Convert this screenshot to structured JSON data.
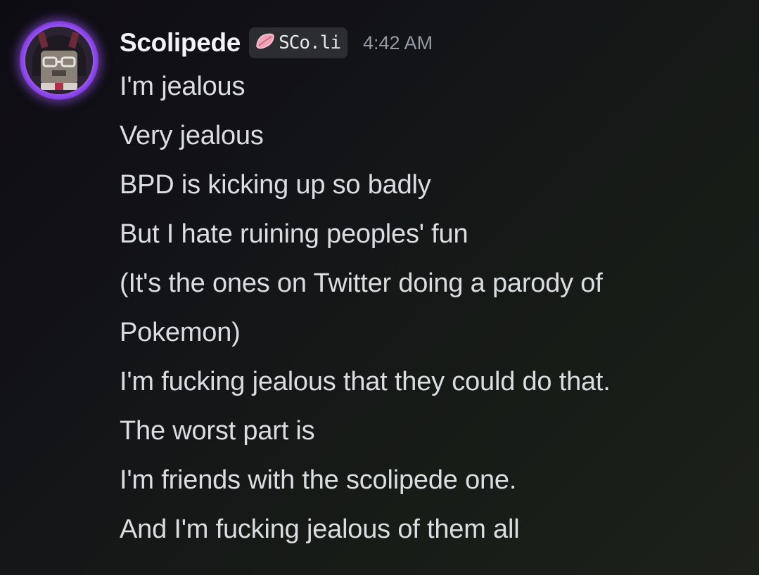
{
  "message": {
    "author": "Scolipede",
    "tag": {
      "icon": "pink-leaf-icon",
      "label": "SCo.li"
    },
    "timestamp": "4:42 AM",
    "avatar_ring_color": "#a768ff",
    "lines": [
      "I'm jealous",
      "Very jealous",
      "BPD is kicking up so badly",
      "But I hate ruining peoples' fun",
      "(It's the ones on Twitter doing a parody of",
      "Pokemon)",
      "I'm fucking jealous that they could do that.",
      "The worst part is",
      "I'm friends with the scolipede one.",
      "And I'm fucking jealous of them all"
    ]
  }
}
